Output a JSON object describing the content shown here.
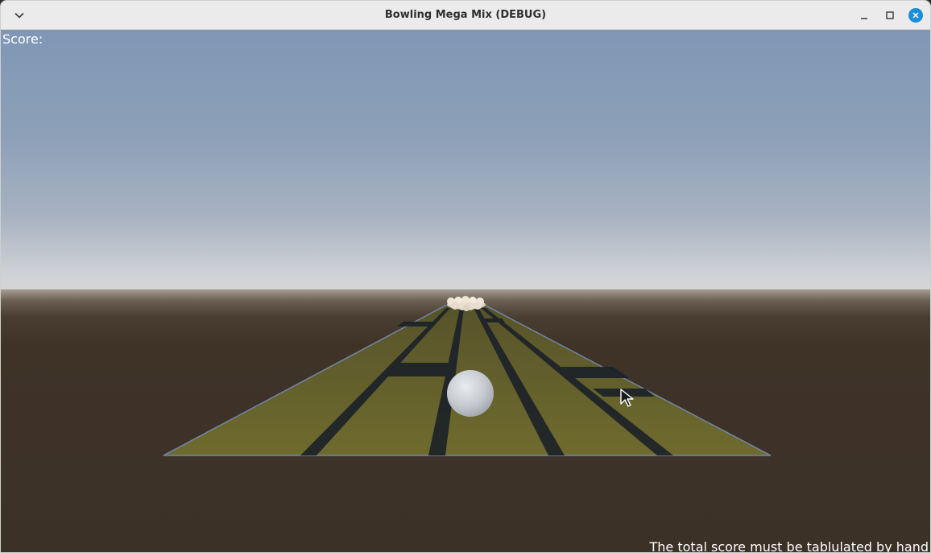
{
  "window": {
    "title": "Bowling Mega Mix (DEBUG)",
    "controls": {
      "menu_icon": "chevron-down-icon",
      "minimize_icon": "minimize-icon",
      "maximize_icon": "maximize-icon",
      "close_icon": "close-icon"
    },
    "accent_color": "#1a8fd8"
  },
  "hud": {
    "score_label": "Score:",
    "note": "The total score must be tablulated by hand"
  },
  "scene": {
    "sky_color": "#8da0b8",
    "ground_color": "#3c3127",
    "lane_color": "#6b6a2c",
    "ball_color": "#c9ccd1",
    "pin_color": "#e8dfcf"
  }
}
